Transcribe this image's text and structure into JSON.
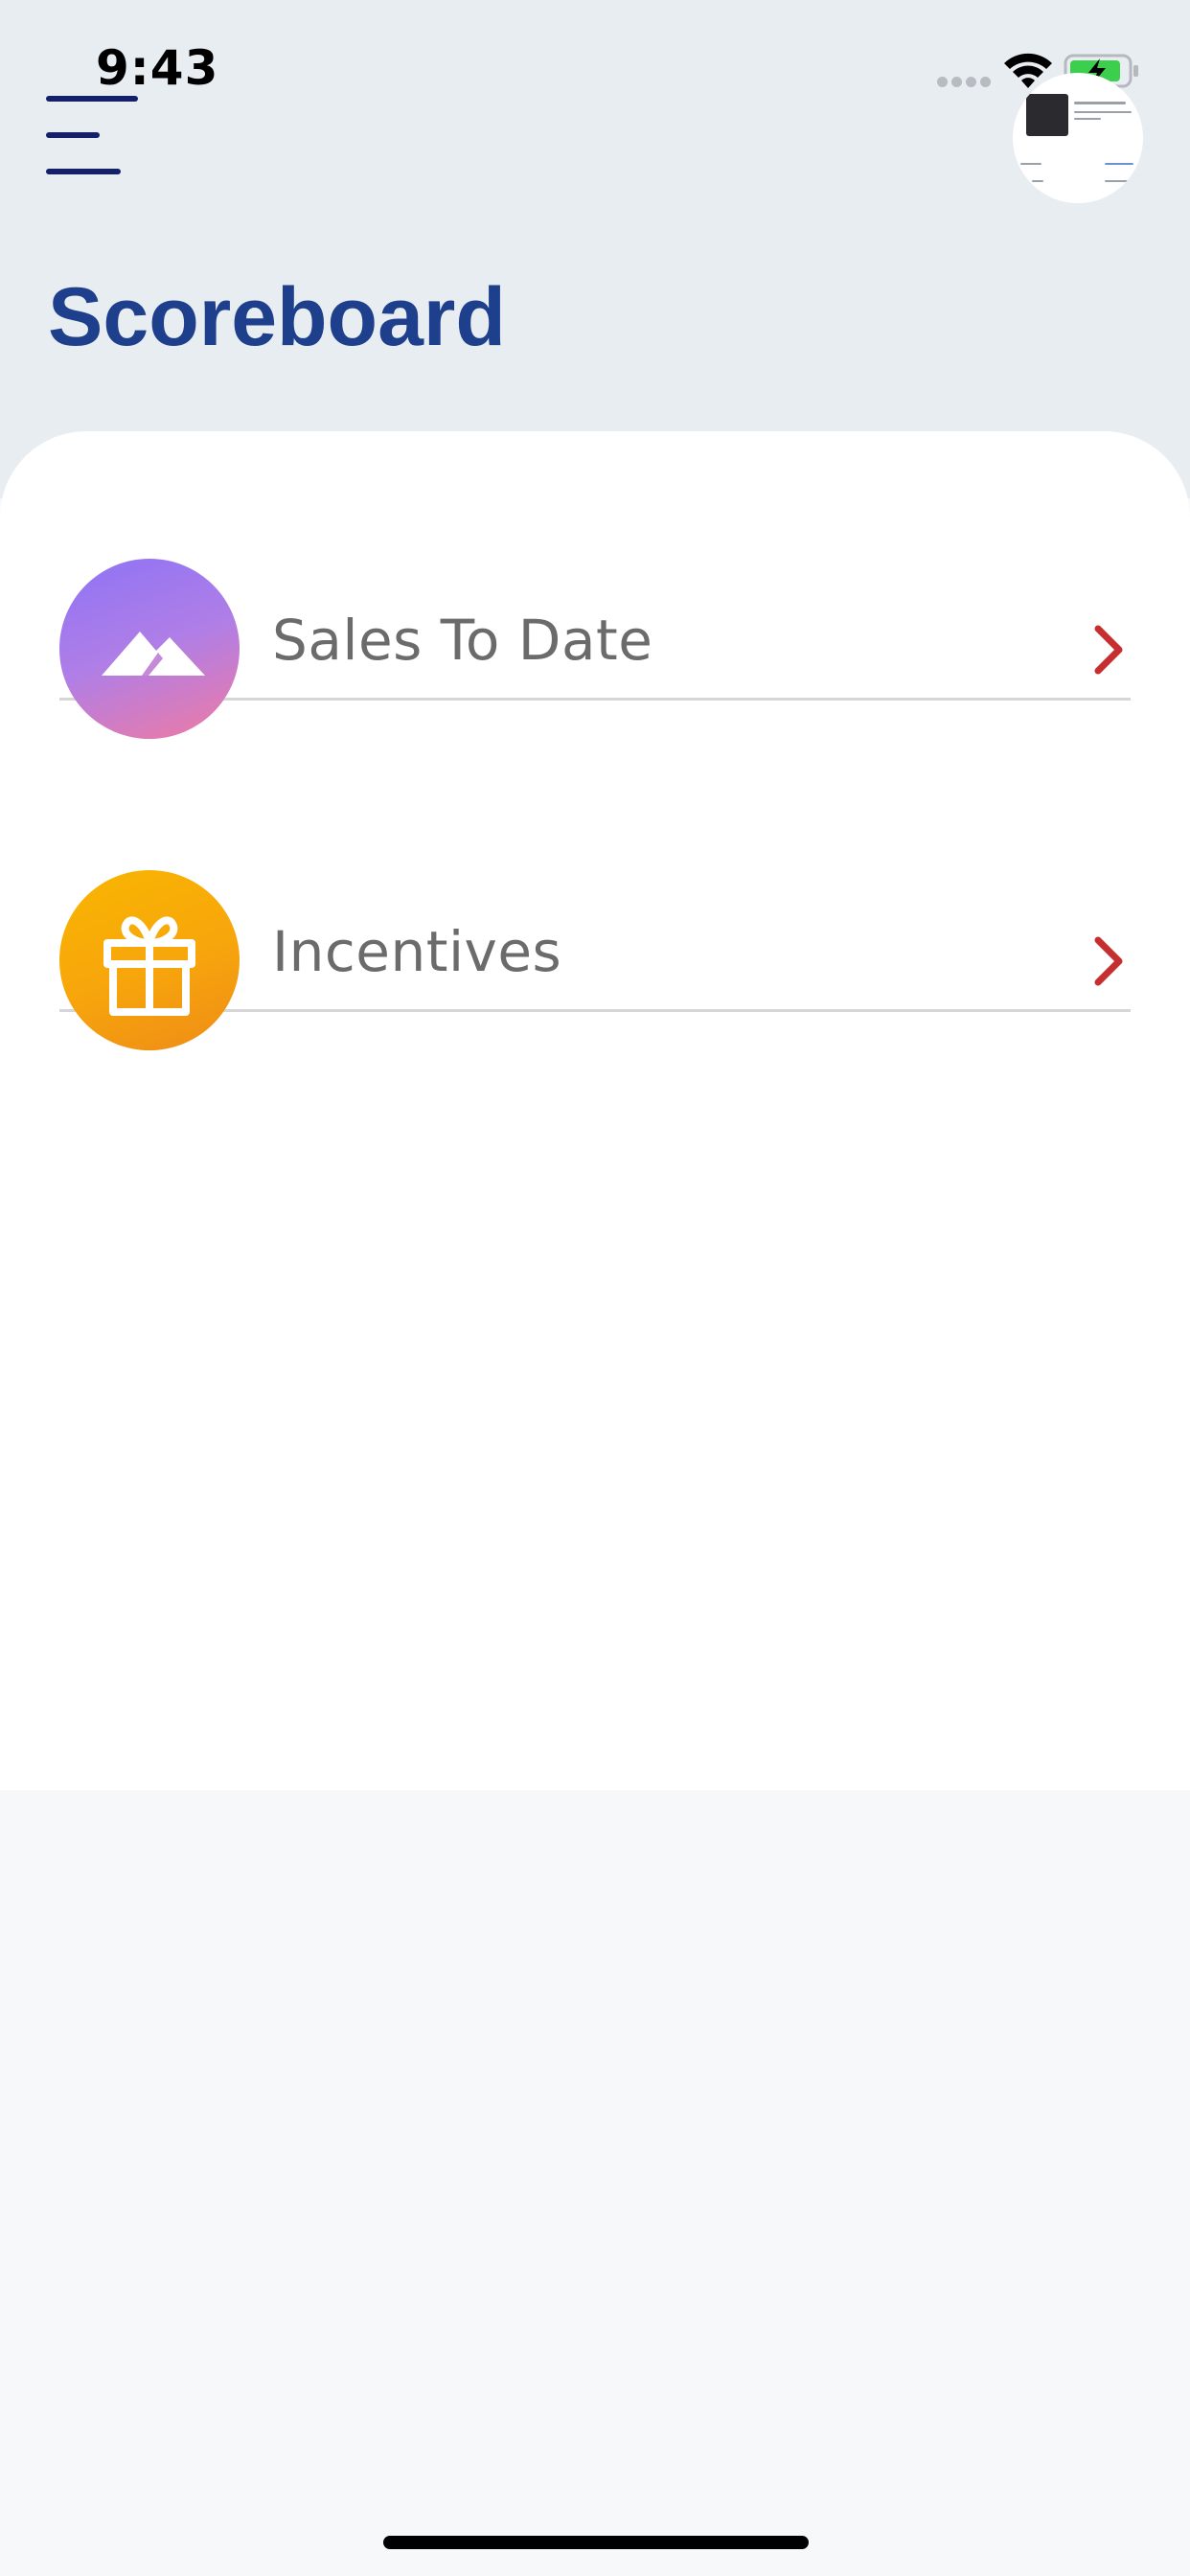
{
  "status_bar": {
    "time": "9:43",
    "icons": [
      "signal-icon",
      "wifi-icon",
      "battery-charging-icon"
    ]
  },
  "header": {
    "menu_icon": "hamburger-menu-icon",
    "avatar_icon": "profile-avatar"
  },
  "page": {
    "title": "Scoreboard"
  },
  "menu": {
    "items": [
      {
        "label": "Sales To Date",
        "icon": "mountain-icon",
        "accent": "#a97ae9"
      },
      {
        "label": "Incentives",
        "icon": "gift-icon",
        "accent": "#f5a90a"
      }
    ],
    "chevron_color": "#c62f2f"
  },
  "colors": {
    "title": "#1e3f8c",
    "menu_bar": "#15206a",
    "header_bg": "#e8edf2",
    "card_bg": "#ffffff",
    "page_bg": "#f7f8fa",
    "label": "#6b6b6b"
  }
}
